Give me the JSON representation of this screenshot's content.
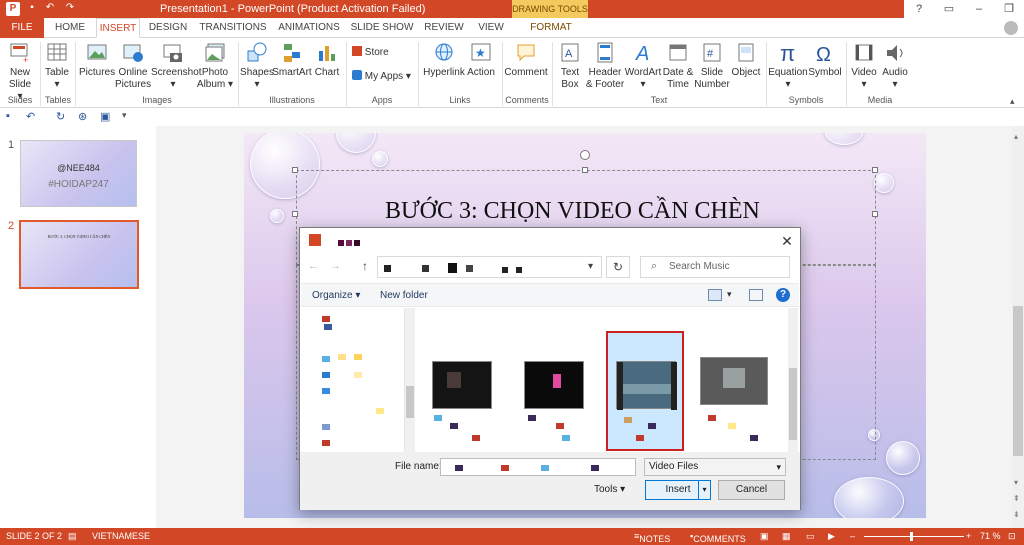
{
  "window": {
    "title": "Presentation1 - PowerPoint (Product Activation Failed)",
    "context_tab_group": "DRAWING TOOLS",
    "app_icon": "P",
    "help": "?"
  },
  "tabs": [
    "FILE",
    "HOME",
    "INSERT",
    "DESIGN",
    "TRANSITIONS",
    "ANIMATIONS",
    "SLIDE SHOW",
    "REVIEW",
    "VIEW",
    "FORMAT"
  ],
  "active_tab": "INSERT",
  "ribbon": {
    "buttons": [
      {
        "label": "New Slide",
        "line2": ""
      },
      {
        "label": "Table",
        "line2": ""
      },
      {
        "label": "Pictures",
        "line2": ""
      },
      {
        "label": "Online",
        "line2": "Pictures"
      },
      {
        "label": "Screenshot",
        "line2": ""
      },
      {
        "label": "Photo",
        "line2": "Album"
      },
      {
        "label": "Shapes",
        "line2": ""
      },
      {
        "label": "SmartArt",
        "line2": ""
      },
      {
        "label": "Chart",
        "line2": ""
      },
      {
        "label": "Hyperlink",
        "line2": ""
      },
      {
        "label": "Action",
        "line2": ""
      },
      {
        "label": "Comment",
        "line2": ""
      },
      {
        "label": "Text",
        "line2": "Box"
      },
      {
        "label": "Header",
        "line2": "& Footer"
      },
      {
        "label": "WordArt",
        "line2": ""
      },
      {
        "label": "Date &",
        "line2": "Time"
      },
      {
        "label": "Slide",
        "line2": "Number"
      },
      {
        "label": "Object",
        "line2": ""
      },
      {
        "label": "Equation",
        "line2": ""
      },
      {
        "label": "Symbol",
        "line2": ""
      },
      {
        "label": "Video",
        "line2": ""
      },
      {
        "label": "Audio",
        "line2": ""
      }
    ],
    "store_label": "Store",
    "my_apps_label": "My Apps",
    "groups": [
      "Slides",
      "Tables",
      "Images",
      "Illustrations",
      "Apps",
      "Links",
      "Comments",
      "Text",
      "Symbols",
      "Media"
    ]
  },
  "slides_panel": {
    "thumbs": [
      {
        "number": "1",
        "line1": "@NEE484",
        "line2": "#HOIDAP247"
      },
      {
        "number": "2",
        "line1": "BƯỚC 3: CHỌN VIDEO CẦN CHÈN",
        "line2": ""
      }
    ]
  },
  "slide": {
    "title": "BƯỚC 3: CHỌN VIDEO CẦN CHÈN"
  },
  "dialog": {
    "organize_label": "Organize",
    "new_folder_label": "New folder",
    "search_placeholder": "Search Music",
    "file_name_label": "File name:",
    "file_type_value": "Video Files",
    "tools_label": "Tools",
    "insert_label": "Insert",
    "cancel_label": "Cancel"
  },
  "status_bar": {
    "slide_info": "SLIDE 2 OF 2",
    "language": "VIETNAMESE",
    "notes": "NOTES",
    "comments": "COMMENTS",
    "zoom": "71 %"
  },
  "colors": {
    "accent": "#d24726",
    "selection_border": "#cc1f1f",
    "primary_button": "#0078d7"
  }
}
